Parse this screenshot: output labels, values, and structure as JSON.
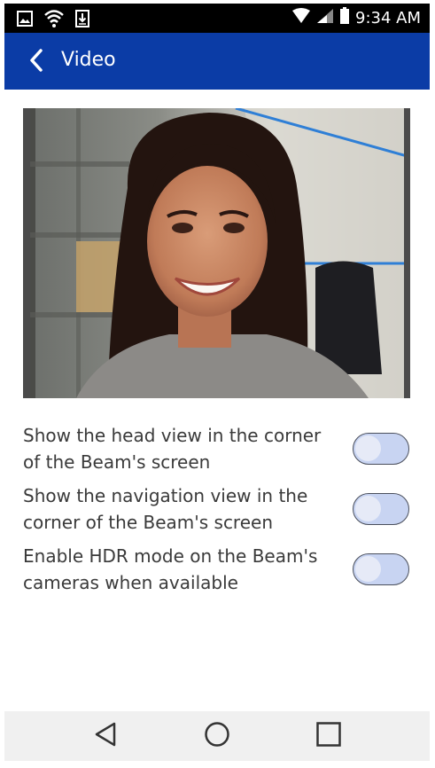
{
  "status_bar": {
    "time": "9:34 AM",
    "icons": [
      "image-icon",
      "wifi-icon",
      "download-icon",
      "signal-wifi-icon",
      "cell-signal-icon",
      "battery-icon"
    ]
  },
  "app_bar": {
    "title": "Video",
    "back_icon": "chevron-left-icon",
    "background": "#0b3ca6"
  },
  "video_preview": {
    "content": "camera-head-view-image"
  },
  "settings": [
    {
      "label": "Show the head view in the corner of the Beam's screen",
      "enabled": false
    },
    {
      "label": "Show the navigation view in the corner of the Beam's screen",
      "enabled": false
    },
    {
      "label": "Enable HDR mode on the Beam's cameras when available",
      "enabled": false
    }
  ],
  "nav_bar": {
    "buttons": [
      "back-triangle-icon",
      "home-circle-icon",
      "recents-square-icon"
    ]
  }
}
